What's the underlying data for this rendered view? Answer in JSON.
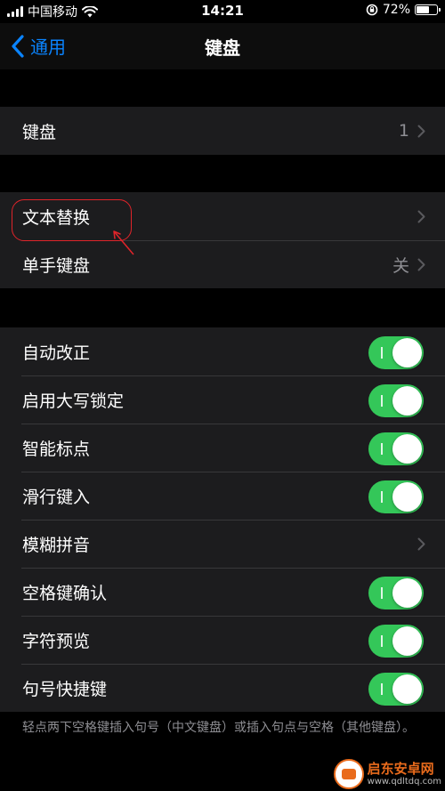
{
  "status_bar": {
    "carrier": "中国移动",
    "time": "14:21",
    "battery_percent": "72%",
    "battery_level": 0.72,
    "signal_bars": 4,
    "wifi_icon": "wifi-icon",
    "rotation_lock_icon": "rotation-lock-icon"
  },
  "nav": {
    "back_label": "通用",
    "title": "键盘"
  },
  "sections": {
    "keyboards": {
      "label": "键盘",
      "value": "1"
    },
    "text": [
      {
        "label": "文本替换"
      },
      {
        "label": "单手键盘",
        "value": "关"
      }
    ],
    "settings": [
      {
        "label": "自动改正",
        "type": "toggle",
        "on": true
      },
      {
        "label": "启用大写锁定",
        "type": "toggle",
        "on": true
      },
      {
        "label": "智能标点",
        "type": "toggle",
        "on": true
      },
      {
        "label": "滑行键入",
        "type": "toggle",
        "on": true
      },
      {
        "label": "模糊拼音",
        "type": "link"
      },
      {
        "label": "空格键确认",
        "type": "toggle",
        "on": true
      },
      {
        "label": "字符预览",
        "type": "toggle",
        "on": true
      },
      {
        "label": "句号快捷键",
        "type": "toggle",
        "on": true
      }
    ]
  },
  "footer": "轻点两下空格键插入句号（中文键盘）或插入句点与空格（其他键盘）。",
  "watermark": {
    "name": "启东安卓网",
    "url": "www.qdltdq.com"
  },
  "colors": {
    "accent": "#0a84ff",
    "toggle_on": "#34c759",
    "cell_background": "#1c1c1e",
    "annotation": "#e0242a"
  }
}
